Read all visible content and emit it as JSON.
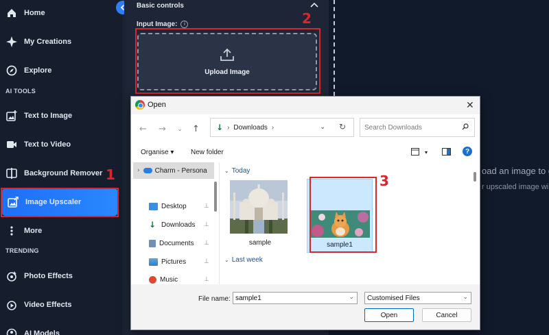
{
  "sidebar": {
    "items": [
      {
        "label": "Home",
        "icon": "home-icon"
      },
      {
        "label": "My Creations",
        "icon": "sparkle-icon"
      },
      {
        "label": "Explore",
        "icon": "compass-icon"
      }
    ],
    "ai_tools_label": "AI TOOLS",
    "tools": [
      {
        "label": "Text to Image",
        "icon": "image-plus-icon"
      },
      {
        "label": "Text to Video",
        "icon": "video-icon"
      },
      {
        "label": "Background Remover",
        "icon": "split-icon"
      },
      {
        "label": "Image Upscaler",
        "icon": "upscale-icon",
        "active": true
      },
      {
        "label": "More",
        "icon": "more-vertical-icon"
      }
    ],
    "trending_label": "TRENDING",
    "trending": [
      {
        "label": "Photo Effects",
        "icon": "photo-effects-icon"
      },
      {
        "label": "Video Effects",
        "icon": "video-effects-icon"
      },
      {
        "label": "AI Models",
        "icon": "ai-models-icon"
      }
    ]
  },
  "panel": {
    "title": "Basic controls",
    "input_label": "Input Image:",
    "info_glyph": "i",
    "upload_label": "Upload Image"
  },
  "background_hint": {
    "line1": "oad an image to g",
    "line2": "r upscaled image will"
  },
  "annotations": {
    "n1": "1",
    "n2": "2",
    "n3": "3",
    "color": "#d9262c"
  },
  "dialog": {
    "title": "Open",
    "close_glyph": "✕",
    "address": {
      "location": "Downloads",
      "sep": "›"
    },
    "search_placeholder": "Search Downloads",
    "toolbar": {
      "organise": "Organise ▾",
      "new_folder": "New folder",
      "help": "?"
    },
    "nav_pane": {
      "cloud": "Charm - Persona",
      "items": [
        {
          "label": "Desktop"
        },
        {
          "label": "Downloads"
        },
        {
          "label": "Documents"
        },
        {
          "label": "Pictures"
        },
        {
          "label": "Music"
        }
      ],
      "pin_glyph": "📌"
    },
    "groups": {
      "today": "Today",
      "last_week": "Last week"
    },
    "files": [
      {
        "name": "sample",
        "selected": false
      },
      {
        "name": "sample1",
        "selected": true
      }
    ],
    "footer": {
      "file_name_label": "File name:",
      "file_name_value": "sample1",
      "file_type": "Customised Files",
      "open_label": "Open",
      "cancel_label": "Cancel"
    }
  },
  "colors": {
    "accent": "#2a88ff",
    "sidebar_bg": "#161e2e",
    "panel_bg": "#1d2536"
  }
}
